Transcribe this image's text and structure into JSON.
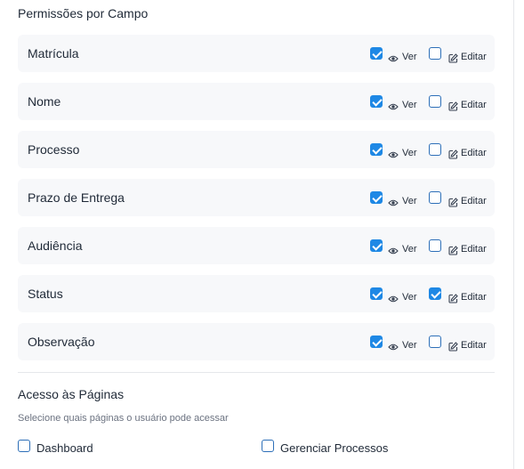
{
  "field_permissions": {
    "title": "Permissões por Campo",
    "view_label": "Ver",
    "edit_label": "Editar",
    "fields": [
      {
        "label": "Matrícula",
        "view": true,
        "edit": false
      },
      {
        "label": "Nome",
        "view": true,
        "edit": false
      },
      {
        "label": "Processo",
        "view": true,
        "edit": false
      },
      {
        "label": "Prazo de Entrega",
        "view": true,
        "edit": false
      },
      {
        "label": "Audiência",
        "view": true,
        "edit": false
      },
      {
        "label": "Status",
        "view": true,
        "edit": true
      },
      {
        "label": "Observação",
        "view": true,
        "edit": false
      }
    ]
  },
  "page_access": {
    "title": "Acesso às Páginas",
    "subtitle": "Selecione quais páginas o usuário pode acessar",
    "pages": [
      {
        "label": "Dashboard",
        "checked": false
      },
      {
        "label": "Gerenciar Processos",
        "checked": false
      }
    ]
  },
  "colors": {
    "checkbox_checked": "#1e88e5",
    "checkbox_border": "#2d6fb8",
    "row_background": "#f7f8fa"
  },
  "icons": {
    "view": "eye-icon",
    "edit": "pencil-square-icon"
  }
}
